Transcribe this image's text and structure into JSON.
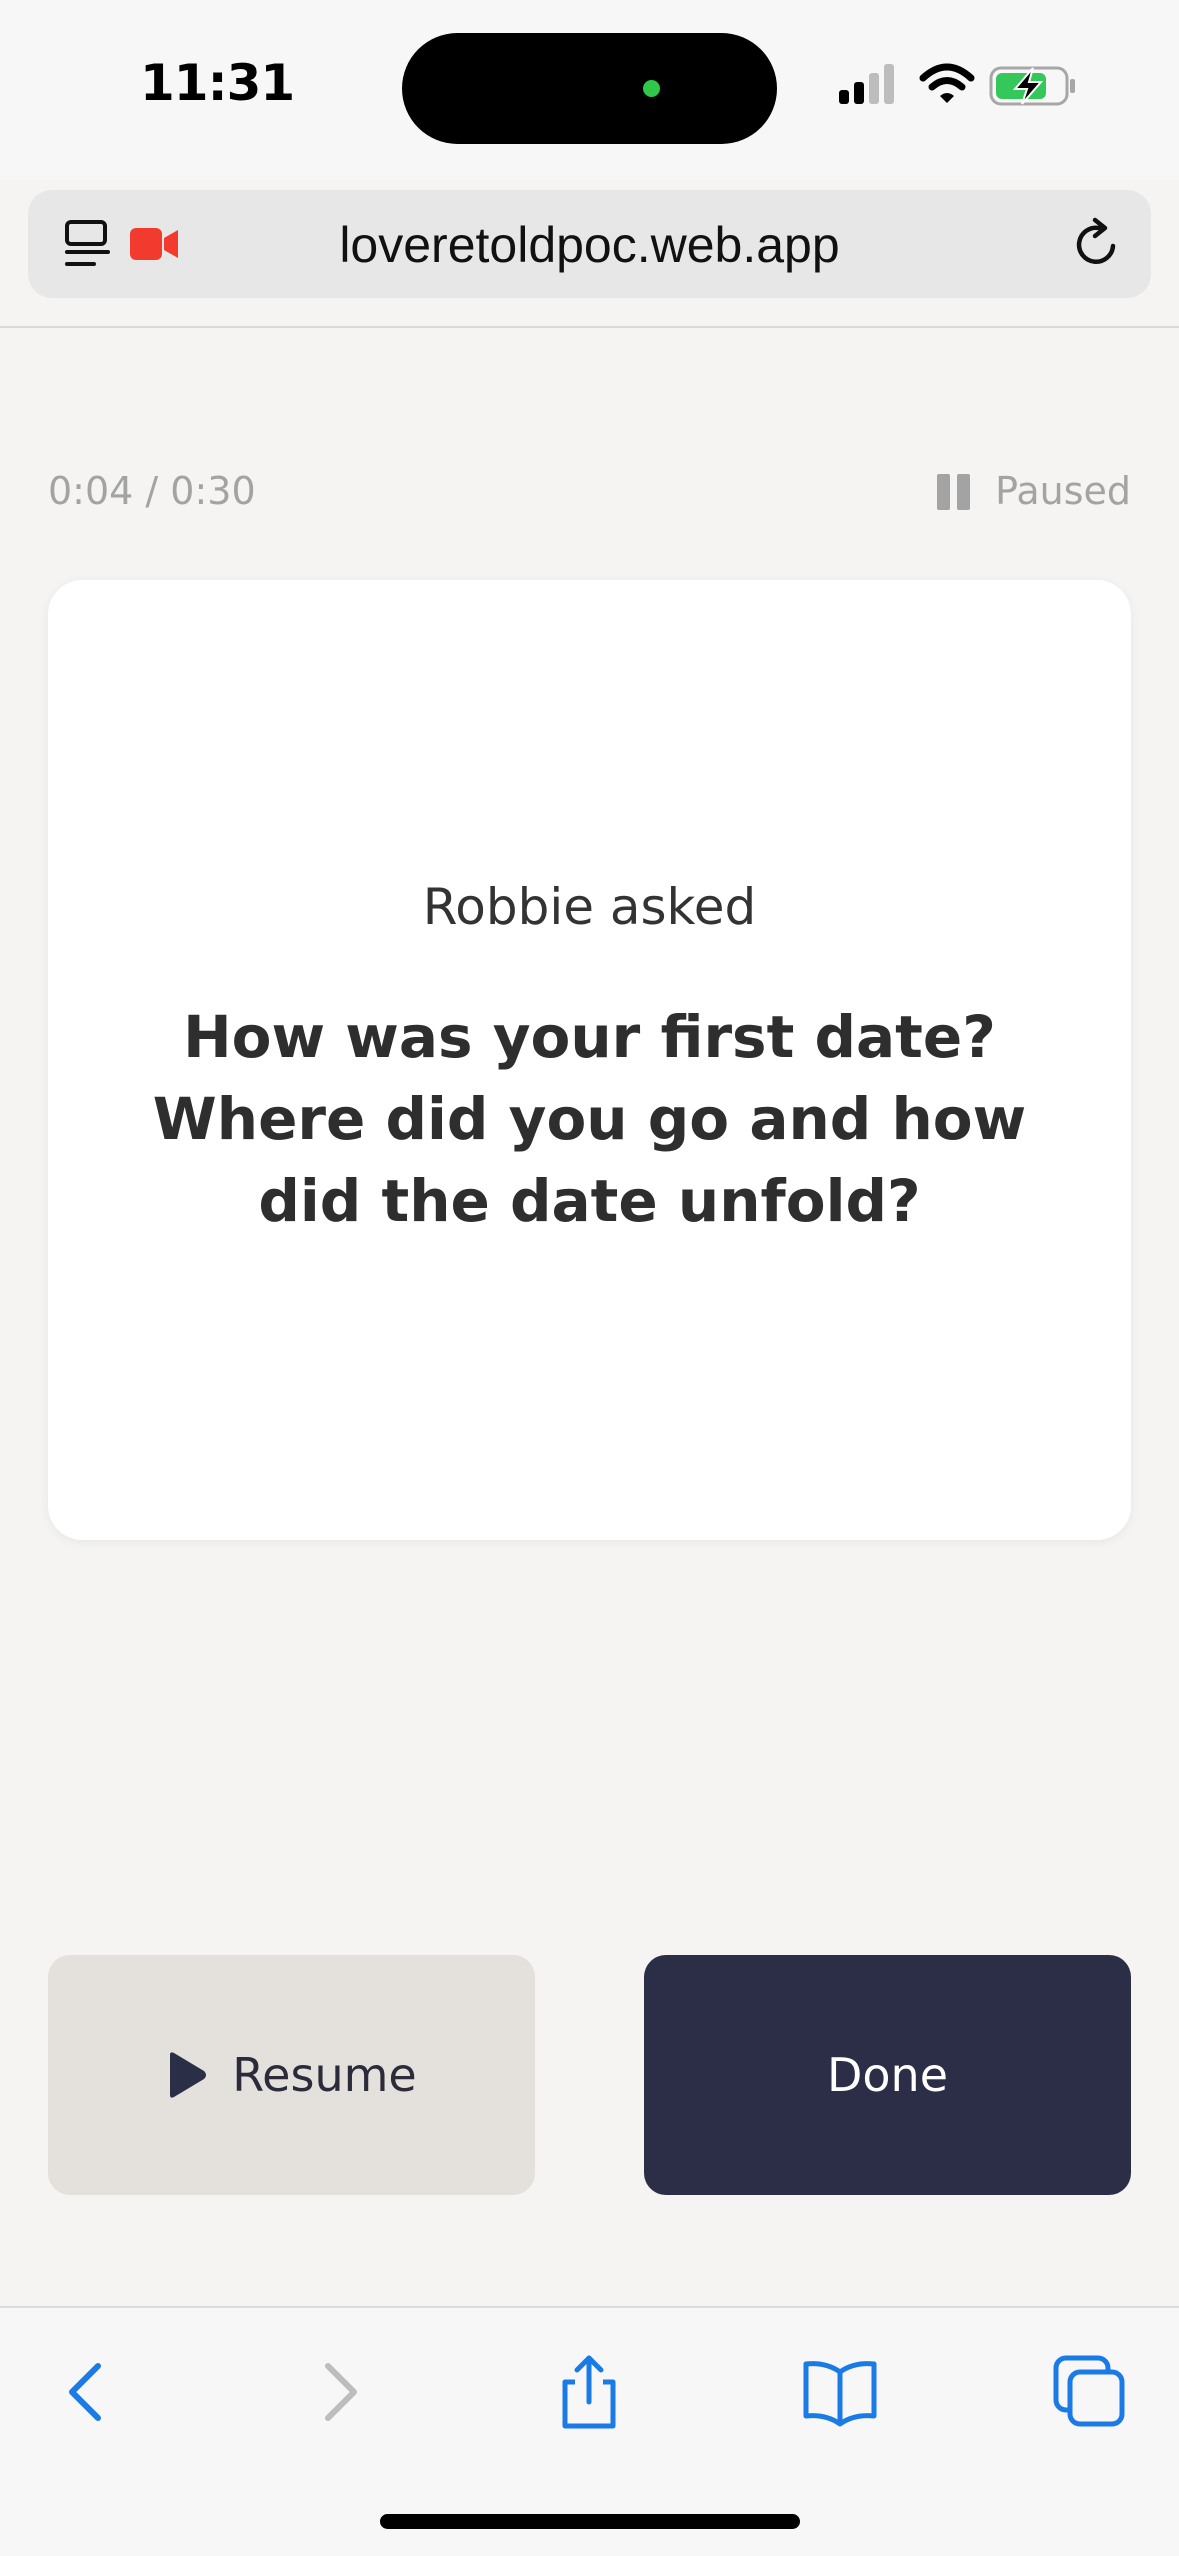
{
  "status_bar": {
    "time": "11:31",
    "icons": [
      "signal-icon",
      "wifi-icon",
      "battery-charging-icon"
    ]
  },
  "browser": {
    "url": "loveretoldpoc.web.app",
    "icons": [
      "reader-mode-icon",
      "camera-recording-icon",
      "reload-icon"
    ],
    "accent_color": "#1a7ae6",
    "recording_color": "#f23b2e"
  },
  "recording": {
    "timer": "0:04 / 0:30",
    "status": "Paused"
  },
  "question_card": {
    "asked_by": "Robbie asked",
    "question": "How was your first date? Where did you go and how did the date unfold?"
  },
  "actions": {
    "resume_label": "Resume",
    "done_label": "Done",
    "done_color": "#2c2e47"
  },
  "toolbar": {
    "icons": [
      "back-icon",
      "forward-icon",
      "share-icon",
      "bookmarks-icon",
      "tabs-icon"
    ]
  }
}
